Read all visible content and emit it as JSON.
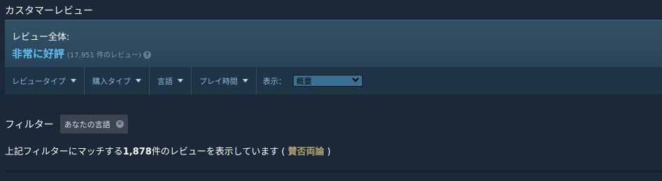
{
  "section_title": "カスタマーレビュー",
  "summary": {
    "overall_label": "レビュー全体:",
    "score": "非常に好評",
    "count": "(17,951 件のレビュー)",
    "help_icon": "question-icon",
    "help_glyph": "?"
  },
  "filter_bar": {
    "dropdowns": [
      {
        "label": "レビュータイプ"
      },
      {
        "label": "購入タイプ"
      },
      {
        "label": "言語"
      },
      {
        "label": "プレイ時間"
      }
    ],
    "display_label": "表示：",
    "display_value": "概要"
  },
  "filters": {
    "label": "フィルター",
    "chips": [
      {
        "label": "あなたの言語",
        "close_glyph": "×"
      }
    ]
  },
  "match": {
    "prefix": "上記フィルターにマッチする",
    "count": "1,878",
    "middle": "件のレビューを表示しています ( ",
    "rating": "賛否両論",
    "suffix": " )"
  },
  "colors": {
    "background": "#1b2838",
    "score_blue": "#66c0f4",
    "mixed_gold": "#b9a074"
  }
}
